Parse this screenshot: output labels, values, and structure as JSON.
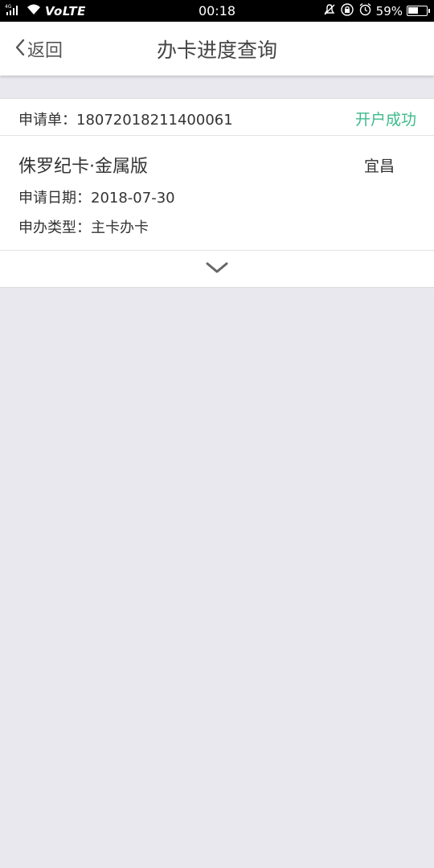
{
  "status_bar": {
    "signal": "4G",
    "volte": "VoLTE",
    "time": "00:18",
    "battery_percent": "59%",
    "battery_level": 0.59
  },
  "nav": {
    "back_label": "返回",
    "title": "办卡进度查询"
  },
  "application": {
    "number": "申请单：18072018211400061",
    "status": "开户成功",
    "card_name": "侏罗纪卡·金属版",
    "city": "宜昌",
    "date": "申请日期：2018-07-30",
    "type": "申办类型：主卡办卡"
  },
  "colors": {
    "status_success": "#3dbb8c",
    "background": "#e9e8ee"
  }
}
